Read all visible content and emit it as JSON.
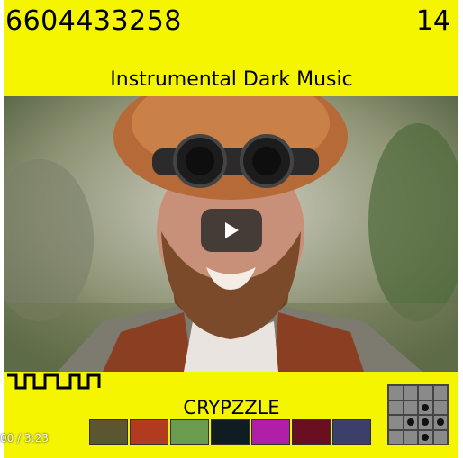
{
  "header": {
    "id_number": "6604433258",
    "count": "14"
  },
  "subtitle": "Instrumental Dark Music",
  "title": "CRYPZZLE",
  "player": {
    "time": "00 / 3:23"
  },
  "palette": [
    "#5c5630",
    "#b23a1e",
    "#6b9b4e",
    "#0f1d22",
    "#b01fa8",
    "#6a0f22",
    "#3b3f6a"
  ],
  "grid_icon": {
    "dots": [
      6,
      9,
      10,
      11,
      14
    ]
  },
  "colors": {
    "background": "#f5f500",
    "text": "#000000"
  }
}
